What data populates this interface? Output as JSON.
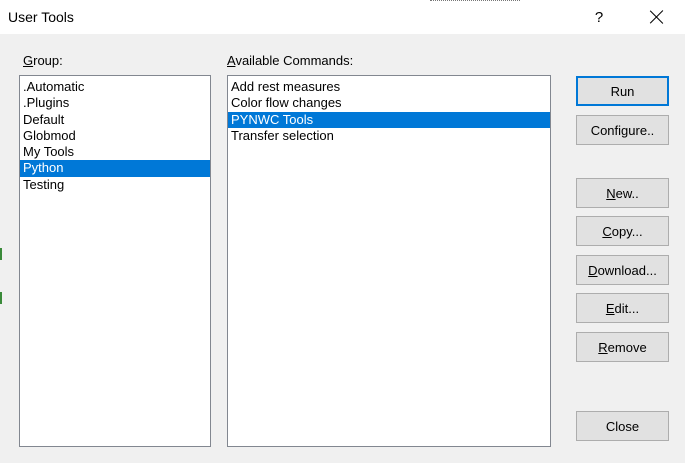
{
  "window": {
    "title": "User Tools",
    "help_label": "?"
  },
  "group": {
    "label_accel": "G",
    "label_rest": "roup:",
    "items": [
      ".Automatic",
      ".Plugins",
      "Default",
      "Globmod",
      "My Tools",
      "Python",
      "Testing"
    ],
    "selected_index": 5
  },
  "commands": {
    "label_accel": "A",
    "label_rest": "vailable Commands:",
    "items": [
      "Add rest measures",
      "Color flow changes",
      "PYNWC Tools",
      "Transfer selection"
    ],
    "selected_index": 2
  },
  "buttons": {
    "run": "Run",
    "configure_pre": "Confi",
    "configure_accel": "g",
    "configure_post": "ure..",
    "new_accel": "N",
    "new_post": "ew..",
    "copy_accel": "C",
    "copy_post": "opy...",
    "download_accel": "D",
    "download_post": "ownload...",
    "edit_accel": "E",
    "edit_post": "dit...",
    "remove_accel": "R",
    "remove_post": "emove",
    "close": "Close"
  },
  "colors": {
    "selection": "#0078d7",
    "dialog_bg": "#f0f0f0",
    "button_bg": "#e1e1e1"
  }
}
